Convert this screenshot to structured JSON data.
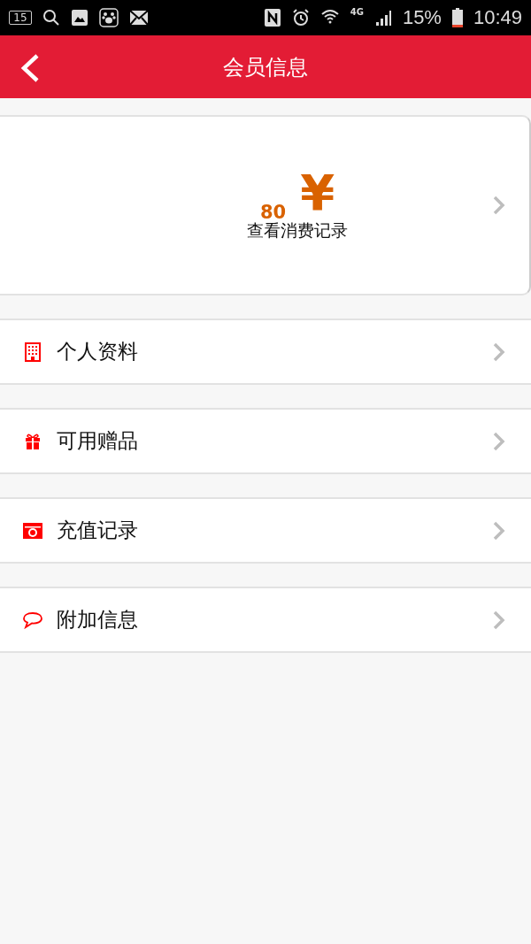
{
  "status_bar": {
    "calendar_day": "15",
    "network": "4G",
    "battery": "15%",
    "time": "10:49"
  },
  "header": {
    "title": "会员信息"
  },
  "balance_card": {
    "amount": "80",
    "currency": "¥",
    "link": "查看消费记录"
  },
  "menu": [
    {
      "kind": "building",
      "label": "个人资料"
    },
    {
      "kind": "gift",
      "label": "可用赠品"
    },
    {
      "kind": "camera",
      "label": "充值记录"
    },
    {
      "kind": "chat",
      "label": "附加信息"
    }
  ]
}
